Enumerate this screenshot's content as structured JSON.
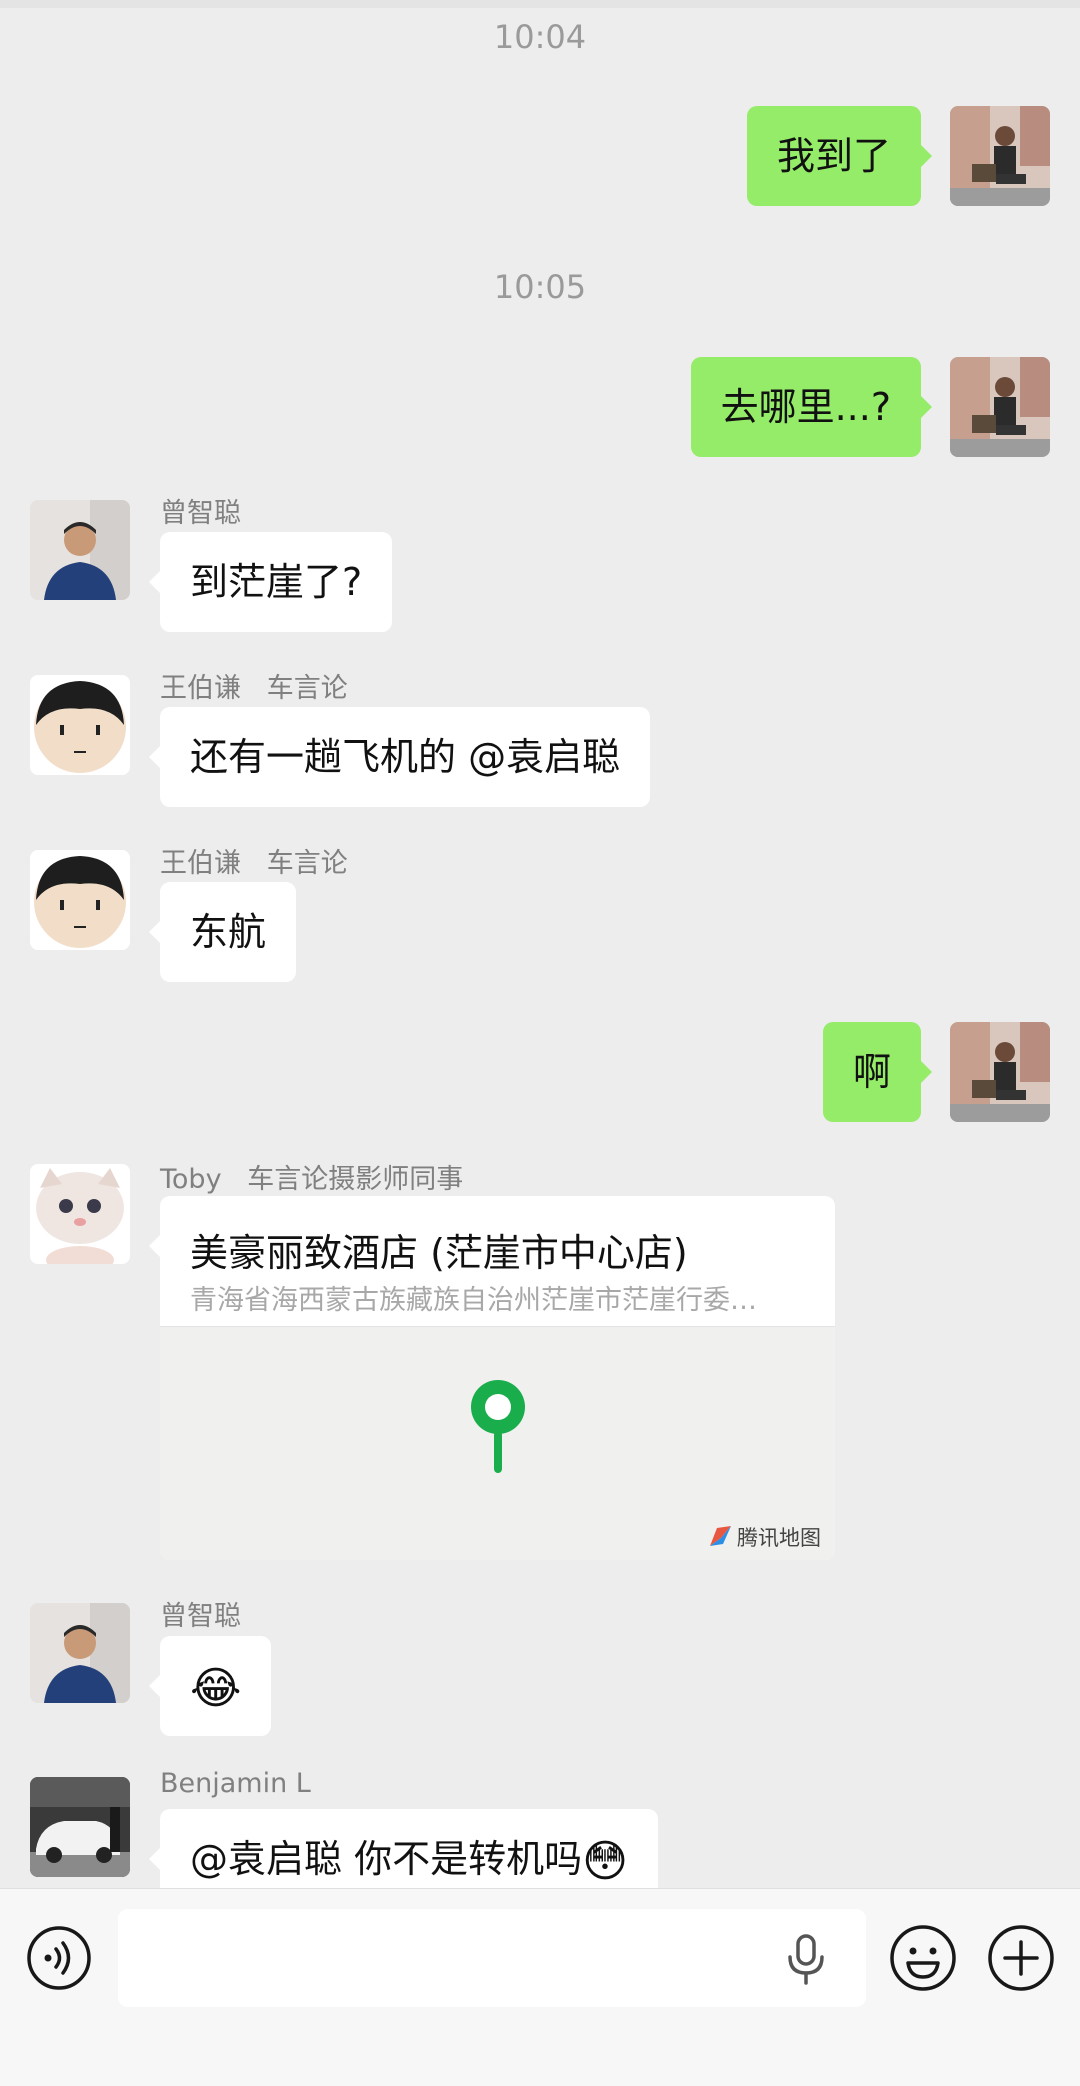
{
  "timestamps": [
    "10:04",
    "10:05"
  ],
  "messages": {
    "m1": {
      "text": "我到了"
    },
    "m2": {
      "text": "去哪里...?"
    },
    "m3": {
      "sender": "曾智聪",
      "text": "到茫崖了?"
    },
    "m4": {
      "sender": "王伯谦   车言论",
      "text": "还有一趟飞机的 @袁启聪"
    },
    "m5": {
      "sender": "王伯谦   车言论",
      "text": "东航"
    },
    "m6": {
      "text": "啊"
    },
    "m7": {
      "sender": "Toby   车言论摄影师同事",
      "location_title": "美豪丽致酒店 (茫崖市中心店)",
      "location_address": "青海省海西蒙古族藏族自治州茫崖市茫崖行委…",
      "map_brand": "腾讯地图"
    },
    "m8": {
      "sender": "曾智聪",
      "emoji": "😂"
    },
    "m9": {
      "sender": "Benjamin L",
      "text": "@袁启聪 你不是转机吗",
      "emoji": "😳"
    }
  },
  "input": {
    "placeholder": "",
    "value": ""
  },
  "colors": {
    "background": "#ededed",
    "outgoing_bubble": "#95ec69",
    "incoming_bubble": "#ffffff",
    "map_pin": "#1aad4b"
  },
  "icons": [
    "voice-toggle-icon",
    "microphone-icon",
    "emoji-icon",
    "plus-icon",
    "map-pin-icon",
    "tencent-map-logo-icon"
  ]
}
